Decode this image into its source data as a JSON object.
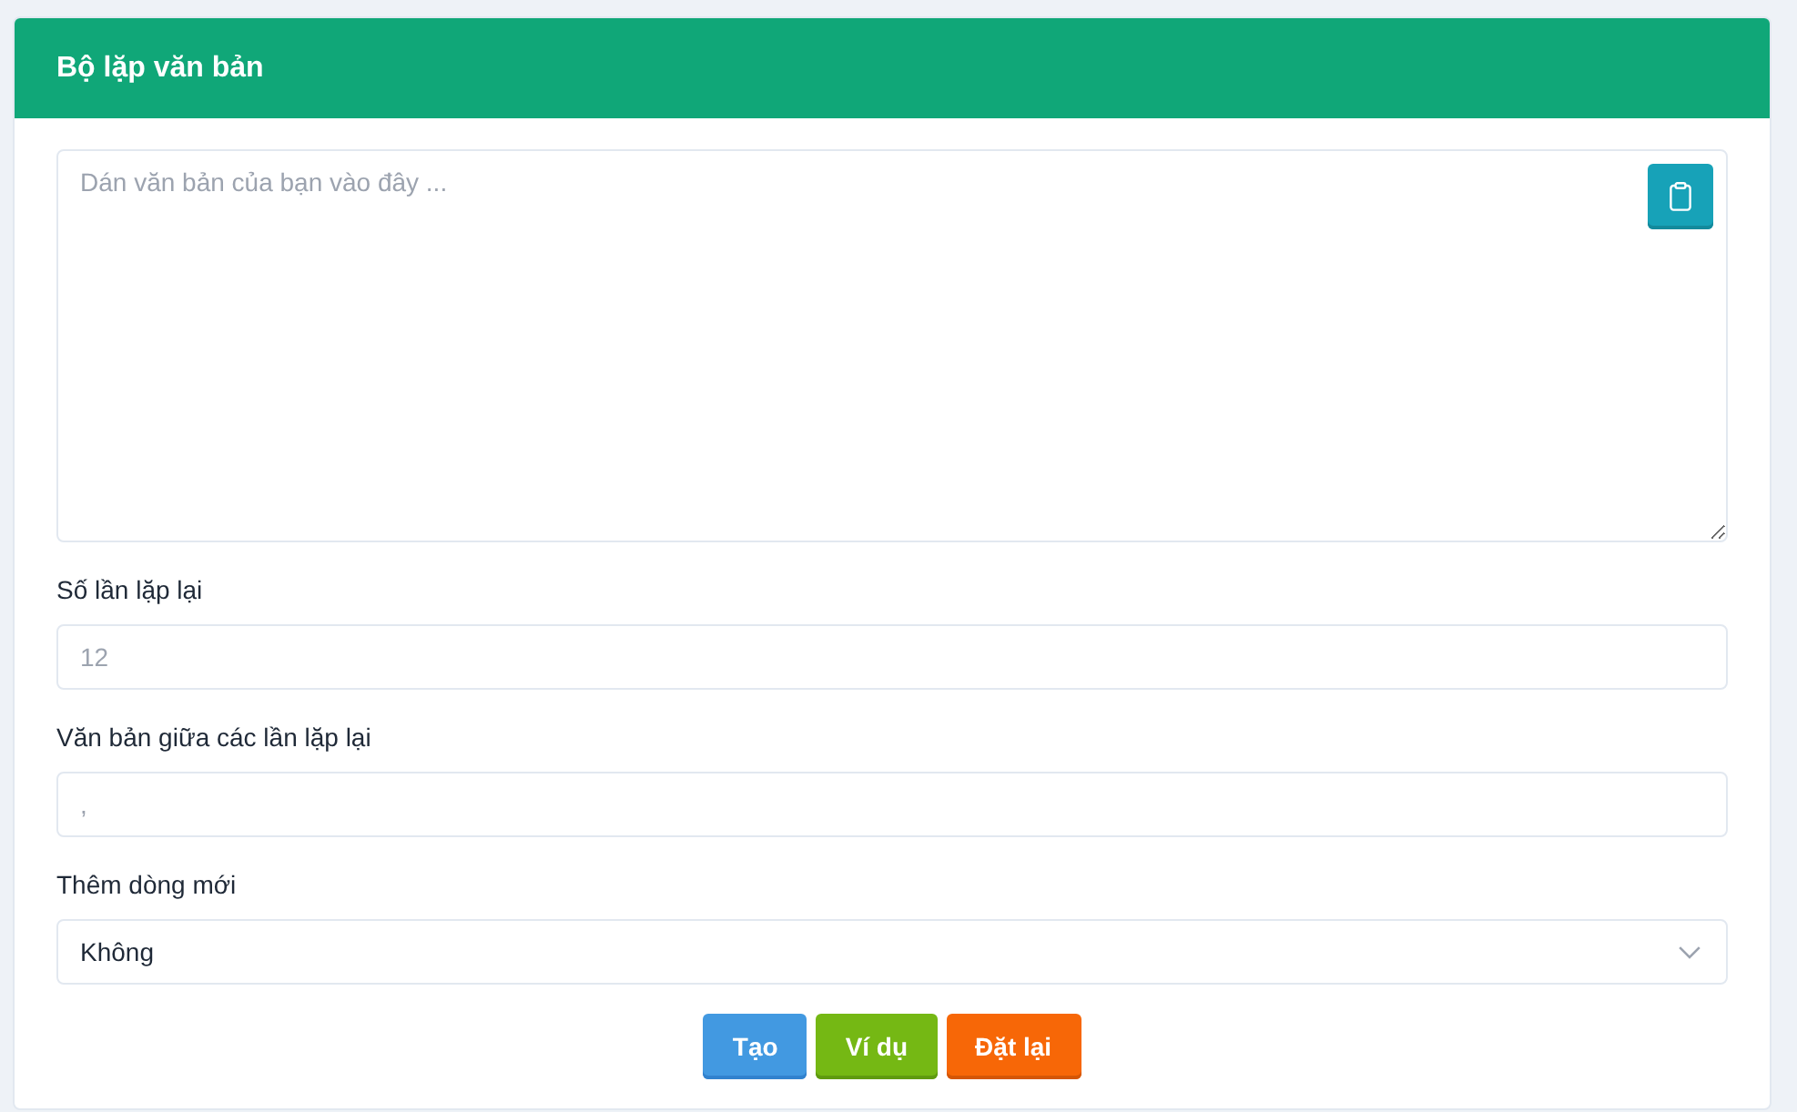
{
  "header": {
    "title": "Bộ lặp văn bản"
  },
  "text_input": {
    "placeholder": "Dán văn bản của bạn vào đây ..."
  },
  "fields": [
    {
      "kind": "input",
      "label": "Số lần lặp lại",
      "placeholder": "12"
    },
    {
      "kind": "input",
      "label": "Văn bản giữa các lần lặp lại",
      "placeholder": ","
    },
    {
      "kind": "select",
      "label": "Thêm dòng mới",
      "value": "Không"
    }
  ],
  "buttons": [
    {
      "label": "Tạo",
      "kind": "primary"
    },
    {
      "label": "Ví dụ",
      "kind": "success"
    },
    {
      "label": "Đặt lại",
      "kind": "warning"
    }
  ]
}
